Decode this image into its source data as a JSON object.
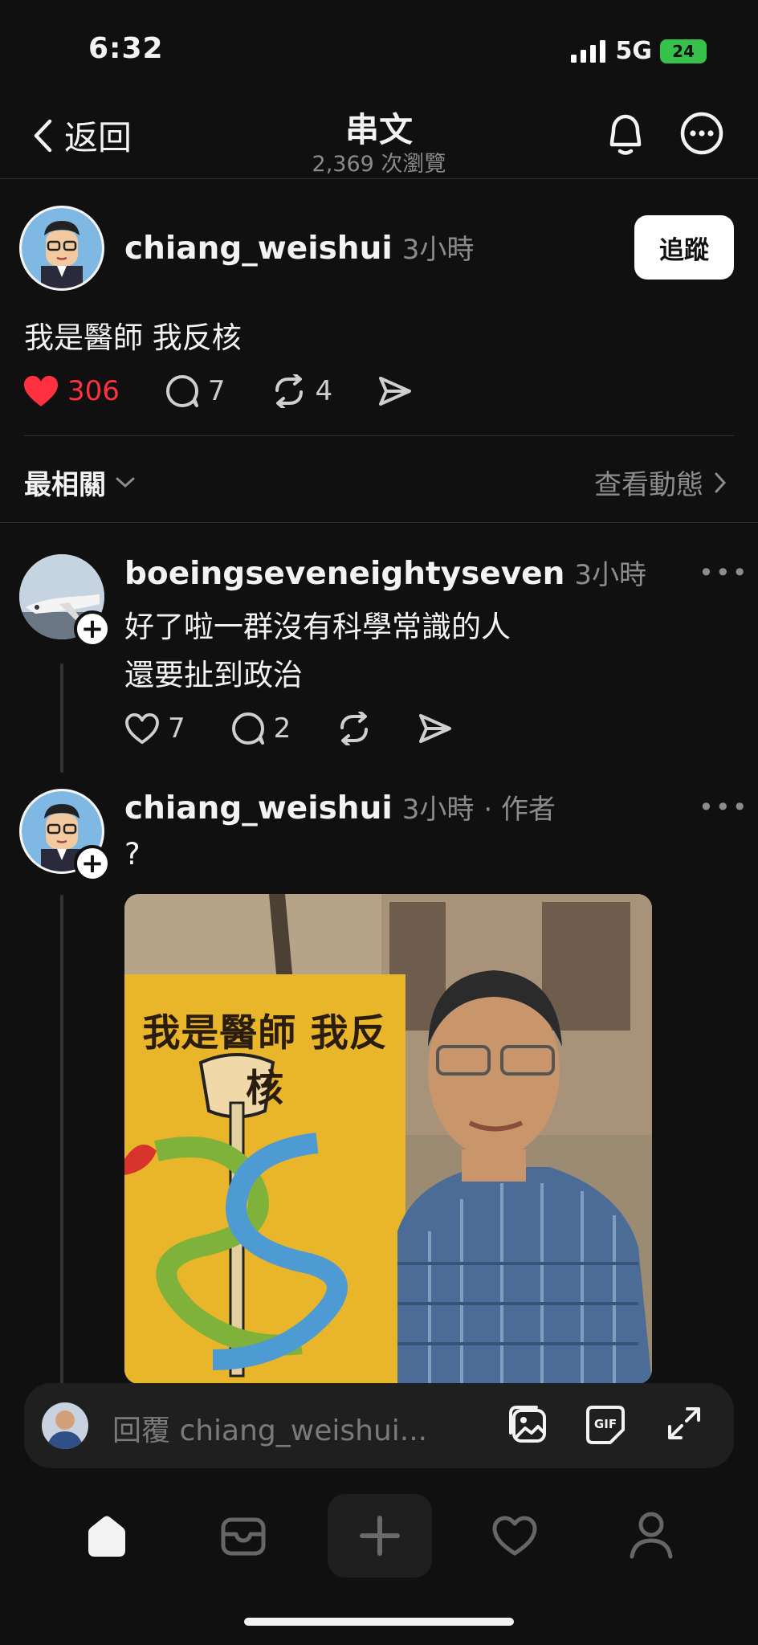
{
  "status_bar": {
    "time": "6:32",
    "network": "5G",
    "battery": "24"
  },
  "header": {
    "back_label": "返回",
    "title": "串文",
    "views": "2,369 次瀏覽"
  },
  "post": {
    "username": "chiang_weishui",
    "time": "3小時",
    "follow_label": "追蹤",
    "text": "我是醫師 我反核",
    "likes": "306",
    "comments": "7",
    "reposts": "4"
  },
  "sort": {
    "label": "最相關",
    "activity_label": "查看動態"
  },
  "replies": [
    {
      "username": "boeingseveneightyseven",
      "time": "3小時",
      "lines": [
        "好了啦一群沒有科學常識的人",
        "還要扯到政治"
      ],
      "likes": "7",
      "comments": "2"
    },
    {
      "username": "chiang_weishui",
      "time": "3小時",
      "author_tag": "· 作者",
      "text": "?",
      "photo_sign_text": "我是醫師 我反核"
    }
  ],
  "reply_bar": {
    "placeholder": "回覆 chiang_weishui..."
  },
  "colors": {
    "background": "#101010",
    "like_red": "#ff3040",
    "muted": "#8c8c8c"
  },
  "icons": [
    "chevron-left-icon",
    "bell-icon",
    "more-icon",
    "heart-icon",
    "comment-icon",
    "repost-icon",
    "share-icon",
    "image-icon",
    "gif-icon",
    "expand-icon",
    "home-icon",
    "inbox-icon",
    "plus-icon",
    "activity-icon",
    "profile-icon"
  ]
}
